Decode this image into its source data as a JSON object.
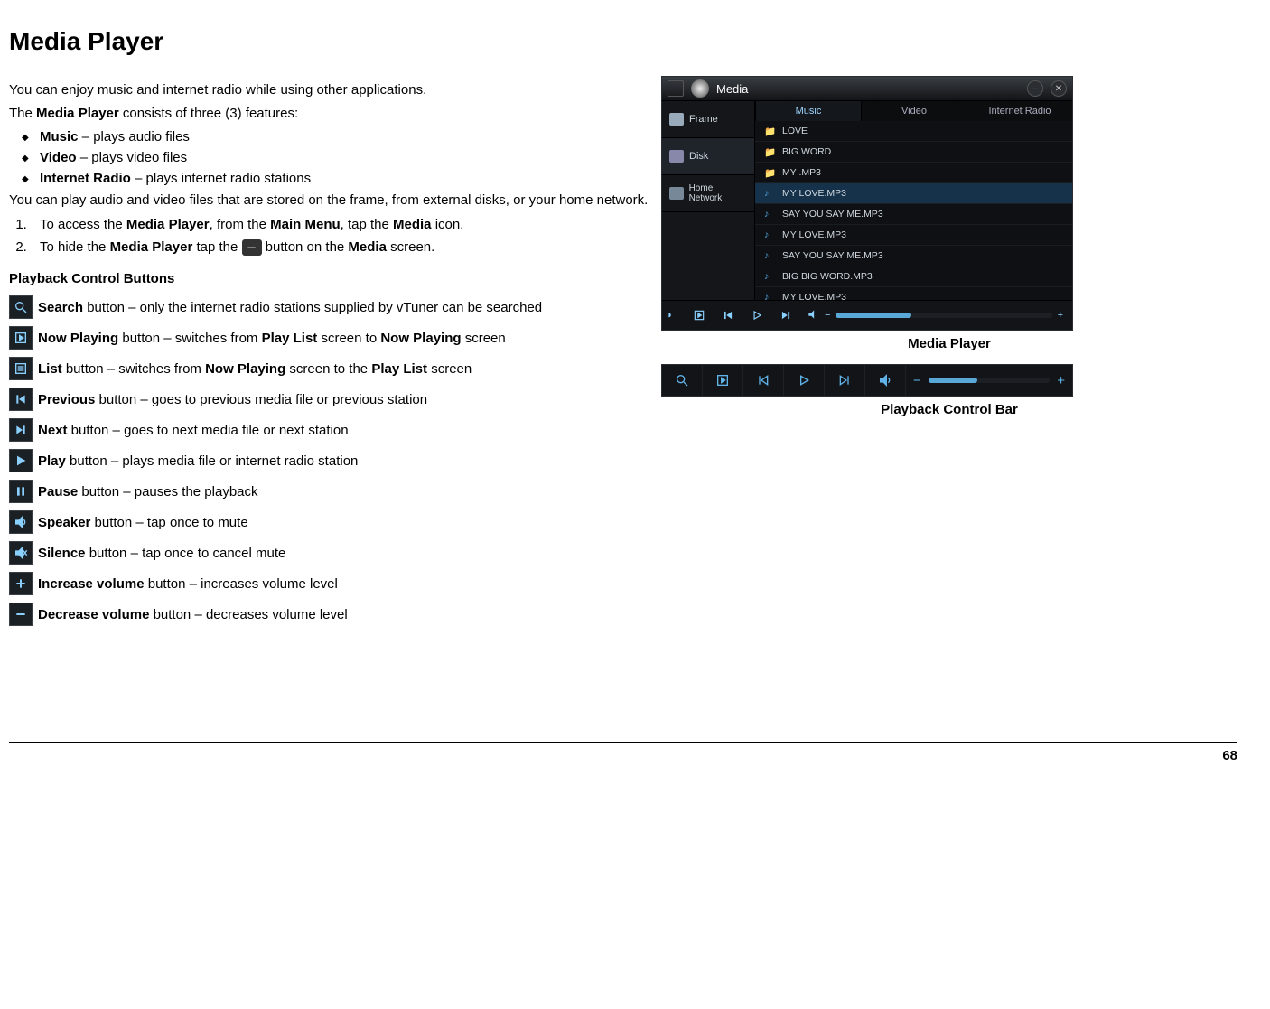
{
  "title": "Media Player",
  "intro": "You can enjoy music and internet radio while using other applications.",
  "features_intro_pre": "The ",
  "features_intro_bold": "Media Player",
  "features_intro_post": " consists of three (3) features:",
  "features": [
    {
      "name": "Music",
      "desc": " – plays audio files"
    },
    {
      "name": "Video",
      "desc": " – plays video files"
    },
    {
      "name": "Internet Radio",
      "desc": " – plays internet radio stations"
    }
  ],
  "storage_note": "You can play audio and video files that are stored on the frame, from external disks, or your home network.",
  "step1_a": "To access the ",
  "step1_b": "Media Player",
  "step1_c": ", from the ",
  "step1_d": "Main Menu",
  "step1_e": ", tap the ",
  "step1_f": "Media",
  "step1_g": " icon.",
  "step2_a": "To hide the ",
  "step2_b": "Media Player",
  "step2_c": " tap the ",
  "step2_d": " button on the ",
  "step2_e": "Media",
  "step2_f": " screen.",
  "playback_heading": "Playback Control Buttons",
  "buttons": {
    "search": {
      "name": "Search",
      "desc": " button – only the internet radio stations supplied by vTuner can be searched"
    },
    "nowplaying": {
      "name": "Now Playing",
      "pre": " button – switches from ",
      "b1": "Play List",
      "mid": " screen to ",
      "b2": "Now Playing",
      "post": " screen"
    },
    "list": {
      "name": "List",
      "pre": " button – switches from ",
      "b1": "Now Playing",
      "mid": " screen to the ",
      "b2": "Play List",
      "post": " screen"
    },
    "previous": {
      "name": "Previous",
      "desc": " button – goes to previous media file or previous station"
    },
    "next": {
      "name": "Next",
      "desc": " button – goes to next media file or next station"
    },
    "play": {
      "name": "Play",
      "desc": " button – plays media file or internet radio station"
    },
    "pause": {
      "name": "Pause",
      "desc": " button – pauses the playback"
    },
    "speaker": {
      "name": "Speaker",
      "desc": " button – tap once to mute"
    },
    "silence": {
      "name": "Silence",
      "desc": " button – tap once to cancel mute"
    },
    "volup": {
      "name": "Increase volume",
      "desc": " button – increases volume level"
    },
    "voldown": {
      "name": "Decrease volume",
      "desc": " button – decreases volume level"
    }
  },
  "captions": {
    "media_player": "Media Player",
    "playback_bar": "Playback Control Bar"
  },
  "ui": {
    "window_title": "Media",
    "sources": [
      "Frame",
      "Disk",
      "Home Network"
    ],
    "tabs": [
      "Music",
      "Video",
      "Internet Radio"
    ],
    "files": [
      {
        "icon": "folder",
        "name": "LOVE"
      },
      {
        "icon": "folder",
        "name": "BIG WORD"
      },
      {
        "icon": "folder",
        "name": "MY .MP3"
      },
      {
        "icon": "music",
        "name": "MY  LOVE.MP3",
        "selected": true
      },
      {
        "icon": "music",
        "name": "SAY YOU SAY ME.MP3"
      },
      {
        "icon": "music",
        "name": "MY  LOVE.MP3"
      },
      {
        "icon": "music",
        "name": "SAY YOU SAY ME.MP3"
      },
      {
        "icon": "music",
        "name": "BIG BIG WORD.MP3"
      },
      {
        "icon": "music",
        "name": "MY  LOVE.MP3"
      }
    ]
  },
  "page_number": "68"
}
